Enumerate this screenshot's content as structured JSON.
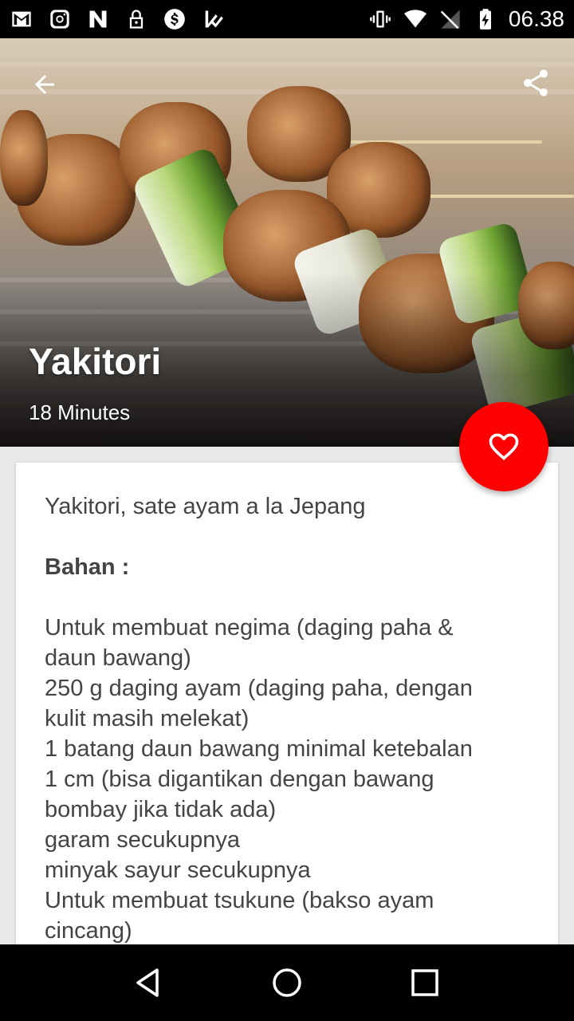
{
  "status_bar": {
    "time": "06.38",
    "left_icons": [
      "gmail-icon",
      "instagram-icon",
      "app-n-icon",
      "lock-icon",
      "dollar-icon",
      "check-flag-icon"
    ],
    "right_icons": [
      "vibrate-icon",
      "wifi-icon",
      "no-signal-icon",
      "battery-charging-icon"
    ]
  },
  "hero": {
    "title": "Yakitori",
    "time": "18 Minutes"
  },
  "content": {
    "description": "Yakitori, sate ayam a la Jepang",
    "section_title": "Bahan :",
    "ingredients": [
      "Untuk membuat negima (daging paha &",
      "daun bawang)",
      "250 g daging ayam (daging paha, dengan",
      "kulit masih melekat)",
      "1 batang daun bawang minimal ketebalan",
      "1 cm (bisa digantikan dengan bawang",
      "bombay jika tidak ada)",
      "garam secukupnya",
      "minyak sayur secukupnya",
      "Untuk membuat tsukune (bakso ayam",
      "cincang)"
    ]
  },
  "colors": {
    "accent": "#ff0000",
    "text": "#444444",
    "background": "#e8e8e8"
  }
}
